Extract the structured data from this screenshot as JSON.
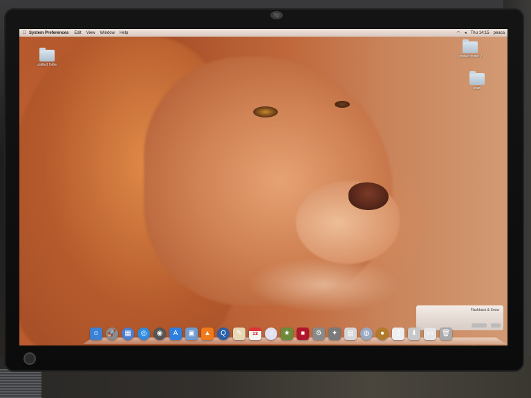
{
  "menubar": {
    "apple_icon": "apple-icon",
    "app_name": "System Preferences",
    "menus": [
      "Edit",
      "View",
      "Window",
      "Help"
    ],
    "status_items": [
      "Thu 14:15",
      "peaca"
    ]
  },
  "desktop_icons": [
    {
      "label": "untitled folder"
    },
    {
      "label": "untitled folder 2"
    },
    {
      "label": "scarl"
    }
  ],
  "dock": {
    "items": [
      {
        "name": "finder-icon",
        "glyph": "☺",
        "color": "#3b82d6"
      },
      {
        "name": "launchpad-icon",
        "glyph": "🚀",
        "color": "#8a8a8a"
      },
      {
        "name": "mission-control-icon",
        "glyph": "▦",
        "color": "#4c7fd1"
      },
      {
        "name": "safari-icon",
        "glyph": "◎",
        "color": "#2f8be0"
      },
      {
        "name": "dashboard-icon",
        "glyph": "◉",
        "color": "#555"
      },
      {
        "name": "app-store-icon",
        "glyph": "A",
        "color": "#2d7fe0"
      },
      {
        "name": "preview-icon",
        "glyph": "▣",
        "color": "#6f9bd0"
      },
      {
        "name": "vlc-icon",
        "glyph": "▲",
        "color": "#f07a1a"
      },
      {
        "name": "quicktime-icon",
        "glyph": "Q",
        "color": "#2b5fa6"
      },
      {
        "name": "textedit-icon",
        "glyph": "✎",
        "color": "#e6d8b6"
      },
      {
        "name": "ical-icon",
        "glyph": "13",
        "color": "#f4f4f4"
      },
      {
        "name": "itunes-icon",
        "glyph": "♫",
        "color": "#e0e0f0"
      },
      {
        "name": "iphoto-icon",
        "glyph": "★",
        "color": "#6d8a3a"
      },
      {
        "name": "photo-booth-icon",
        "glyph": "■",
        "color": "#b1172a"
      },
      {
        "name": "system-preferences-icon",
        "glyph": "⚙",
        "color": "#8a8a8a"
      },
      {
        "name": "utility-icon",
        "glyph": "✦",
        "color": "#7a7a7a"
      },
      {
        "name": "documents-icon",
        "glyph": "▤",
        "color": "#d6d6d6"
      },
      {
        "name": "network-icon",
        "glyph": "◍",
        "color": "#9aa9c0"
      },
      {
        "name": "app-icon",
        "glyph": "●",
        "color": "#b07a2a"
      },
      {
        "name": "document-icon",
        "glyph": "▯",
        "color": "#eeeeee"
      },
      {
        "name": "downloads-icon",
        "glyph": "⬇",
        "color": "#c8c8c8"
      },
      {
        "name": "stack-icon",
        "glyph": "▭",
        "color": "#e6e6e6"
      },
      {
        "name": "trash-icon",
        "glyph": "🗑",
        "color": "#a9a9a9"
      }
    ]
  },
  "notification": {
    "title": "Flashback & Snow"
  },
  "monitor": {
    "brand_icon": "hp-logo-icon"
  }
}
